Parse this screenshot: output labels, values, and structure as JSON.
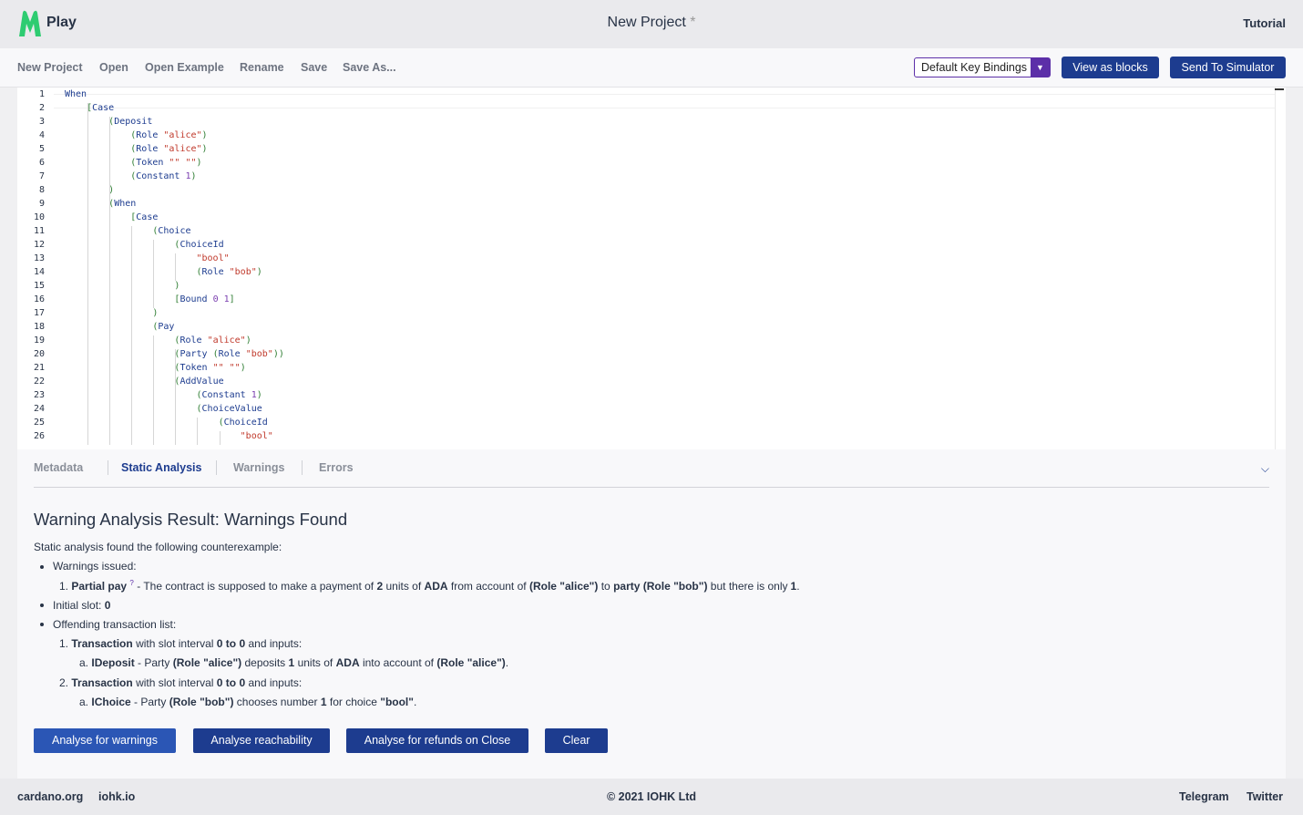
{
  "header": {
    "logo_text": "Play",
    "project_title": "New Project",
    "unsaved_marker": "*",
    "tutorial_label": "Tutorial"
  },
  "menu": {
    "new_project": "New Project",
    "open": "Open",
    "open_example": "Open Example",
    "rename": "Rename",
    "save": "Save",
    "save_as": "Save As...",
    "key_bindings": "Default Key Bindings",
    "view_as_blocks": "View as blocks",
    "send_to_simulator": "Send To Simulator"
  },
  "colors": {
    "primary": "#1d3c8f",
    "accent_purple": "#5c2fa8",
    "logo_green": "#2ecc71",
    "string_red": "#c0392b"
  },
  "editor": {
    "lines": [
      {
        "n": "1",
        "text": "When"
      },
      {
        "n": "2",
        "text": "    [Case"
      },
      {
        "n": "3",
        "text": "        (Deposit"
      },
      {
        "n": "4",
        "text": "            (Role \"alice\")"
      },
      {
        "n": "5",
        "text": "            (Role \"alice\")"
      },
      {
        "n": "6",
        "text": "            (Token \"\" \"\")"
      },
      {
        "n": "7",
        "text": "            (Constant 1)"
      },
      {
        "n": "8",
        "text": "        )"
      },
      {
        "n": "9",
        "text": "        (When"
      },
      {
        "n": "10",
        "text": "            [Case"
      },
      {
        "n": "11",
        "text": "                (Choice"
      },
      {
        "n": "12",
        "text": "                    (ChoiceId"
      },
      {
        "n": "13",
        "text": "                        \"bool\""
      },
      {
        "n": "14",
        "text": "                        (Role \"bob\")"
      },
      {
        "n": "15",
        "text": "                    )"
      },
      {
        "n": "16",
        "text": "                    [Bound 0 1]"
      },
      {
        "n": "17",
        "text": "                )"
      },
      {
        "n": "18",
        "text": "                (Pay"
      },
      {
        "n": "19",
        "text": "                    (Role \"alice\")"
      },
      {
        "n": "20",
        "text": "                    (Party (Role \"bob\"))"
      },
      {
        "n": "21",
        "text": "                    (Token \"\" \"\")"
      },
      {
        "n": "22",
        "text": "                    (AddValue"
      },
      {
        "n": "23",
        "text": "                        (Constant 1)"
      },
      {
        "n": "24",
        "text": "                        (ChoiceValue"
      },
      {
        "n": "25",
        "text": "                            (ChoiceId"
      },
      {
        "n": "26",
        "text": "                                \"bool\""
      }
    ]
  },
  "panel": {
    "tabs": [
      {
        "label": "Metadata",
        "active": false
      },
      {
        "label": "Static Analysis",
        "active": true
      },
      {
        "label": "Warnings",
        "active": false
      },
      {
        "label": "Errors",
        "active": false
      }
    ],
    "result_title": "Warning Analysis Result: Warnings Found",
    "intro": "Static analysis found the following counterexample:",
    "warnings_issued": "Warnings issued:",
    "warning_item": {
      "number": "1.",
      "name": "Partial pay",
      "t1": "- The contract is supposed to make a payment of",
      "amount": "2",
      "t2": "units of",
      "token": "ADA",
      "t3": "from account of",
      "from": "(Role \"alice\")",
      "t4": "to",
      "to": "party (Role \"bob\")",
      "t5": "but there is only",
      "only": "1",
      "t6": "."
    },
    "initial_slot_label": "Initial slot:",
    "initial_slot_value": "0",
    "offending_label": "Offending transaction list:",
    "transactions": [
      {
        "number": "1.",
        "label": "Transaction",
        "t1": "with slot interval",
        "interval": "0 to 0",
        "t2": "and inputs:",
        "input": {
          "letter": "a.",
          "kind": "IDeposit",
          "t1": "- Party",
          "party": "(Role \"alice\")",
          "t2": "deposits",
          "amount": "1",
          "t3": "units of",
          "token": "ADA",
          "t4": "into account of",
          "account": "(Role \"alice\")",
          "t5": "."
        }
      },
      {
        "number": "2.",
        "label": "Transaction",
        "t1": "with slot interval",
        "interval": "0 to 0",
        "t2": "and inputs:",
        "input": {
          "letter": "a.",
          "kind": "IChoice",
          "t1": "- Party",
          "party": "(Role \"bob\")",
          "t2": "chooses number",
          "amount": "1",
          "t3": "for choice",
          "choice": "\"bool\"",
          "t4": "."
        }
      }
    ],
    "buttons": {
      "warnings": "Analyse for warnings",
      "reachability": "Analyse reachability",
      "refunds": "Analyse for refunds on Close",
      "clear": "Clear"
    }
  },
  "footer": {
    "cardano": "cardano.org",
    "iohk": "iohk.io",
    "copyright": "© 2021 IOHK Ltd",
    "telegram": "Telegram",
    "twitter": "Twitter"
  }
}
